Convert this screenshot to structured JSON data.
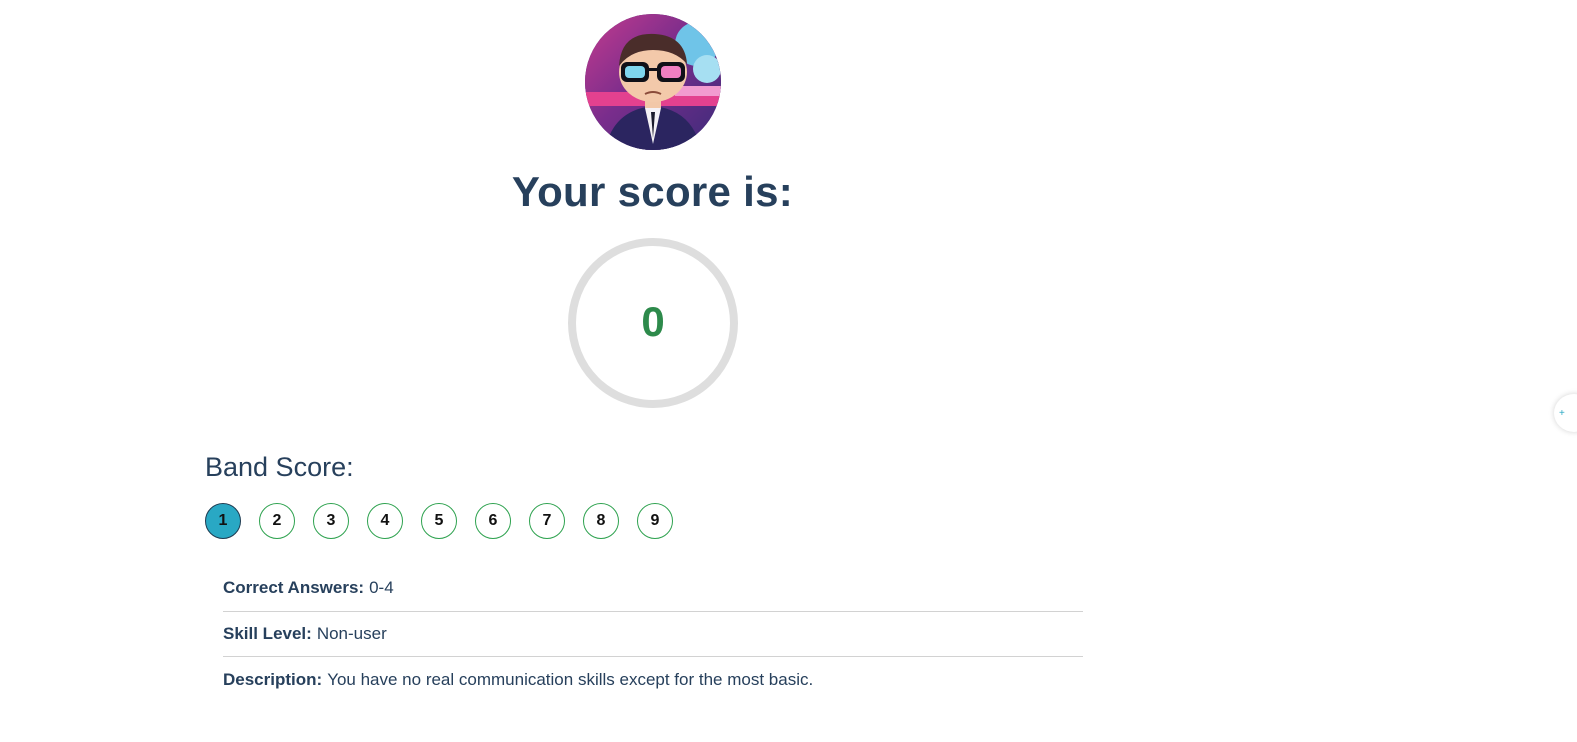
{
  "result": {
    "heading": "Your score is:",
    "score": "0"
  },
  "band": {
    "label": "Band Score:",
    "items": [
      "1",
      "2",
      "3",
      "4",
      "5",
      "6",
      "7",
      "8",
      "9"
    ],
    "selected": "1",
    "accent_color": "#29a8c4",
    "ring_color": "#2ea24f"
  },
  "details": {
    "correct_answers": {
      "label": "Correct Answers:",
      "value": "0-4"
    },
    "skill_level": {
      "label": "Skill Level:",
      "value": "Non-user"
    },
    "description": {
      "label": "Description:",
      "value": "You have no real communication skills except for the most basic."
    }
  },
  "side_widget": {
    "icon": "plus-icon",
    "glyph": "+"
  }
}
